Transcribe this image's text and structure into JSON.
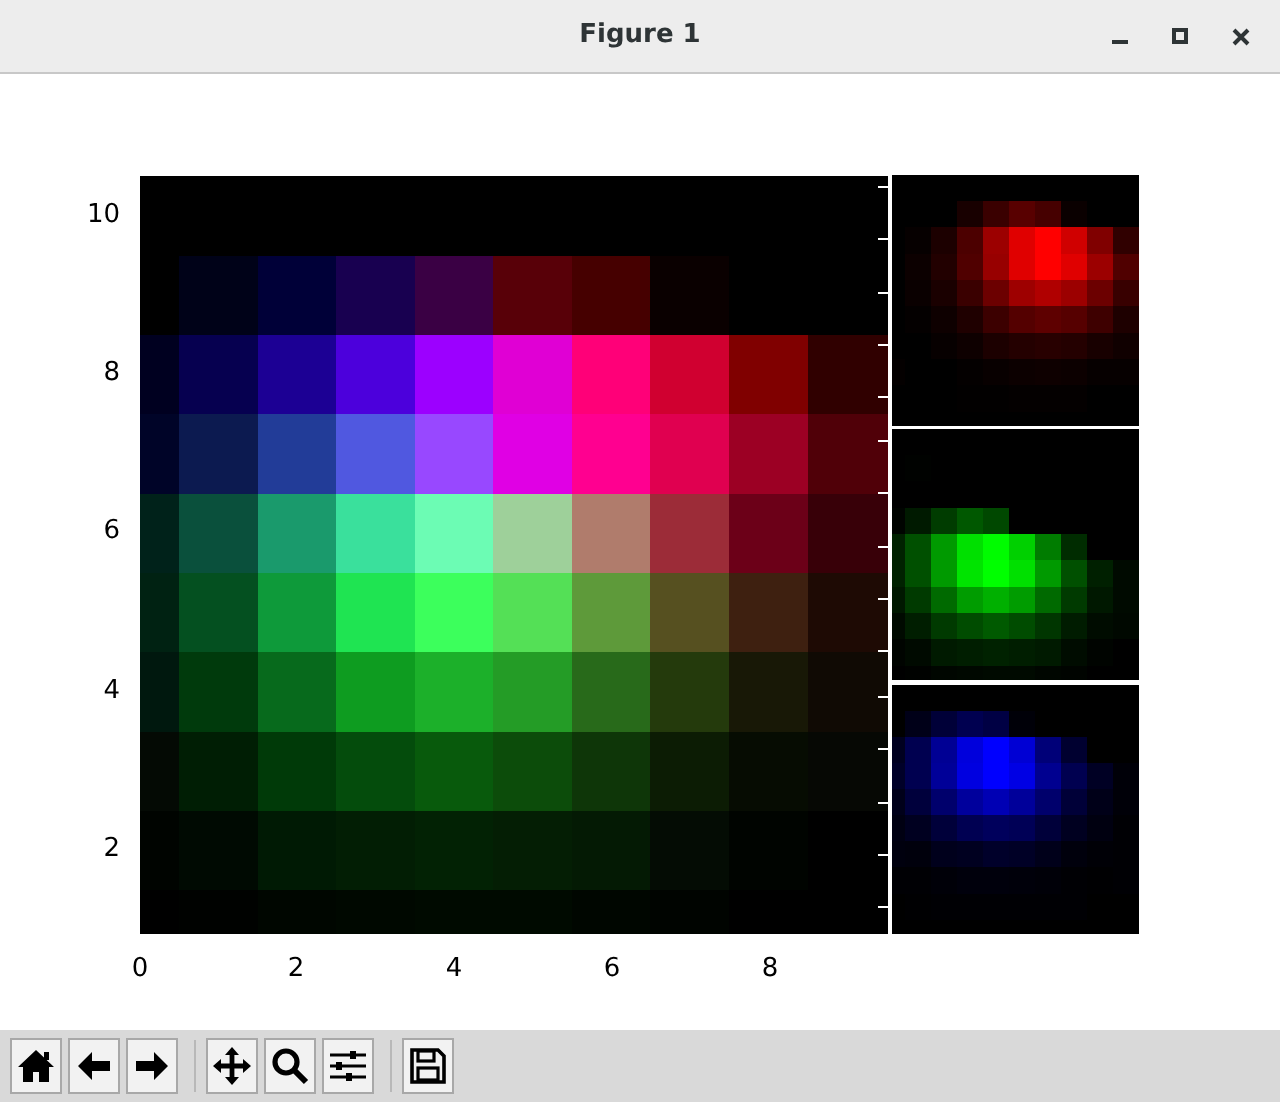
{
  "window": {
    "title": "Figure 1"
  },
  "figure": {
    "yticks": [
      "10",
      "8",
      "6",
      "4",
      "2"
    ],
    "xticks": [
      "0",
      "2",
      "4",
      "6",
      "8"
    ]
  },
  "toolbar": {
    "groups": [
      [
        {
          "kind": "home"
        },
        {
          "kind": "back"
        },
        {
          "kind": "forward"
        }
      ],
      [
        {
          "kind": "pan"
        },
        {
          "kind": "zoom"
        },
        {
          "kind": "configure"
        }
      ],
      [
        {
          "kind": "save"
        }
      ]
    ]
  }
}
